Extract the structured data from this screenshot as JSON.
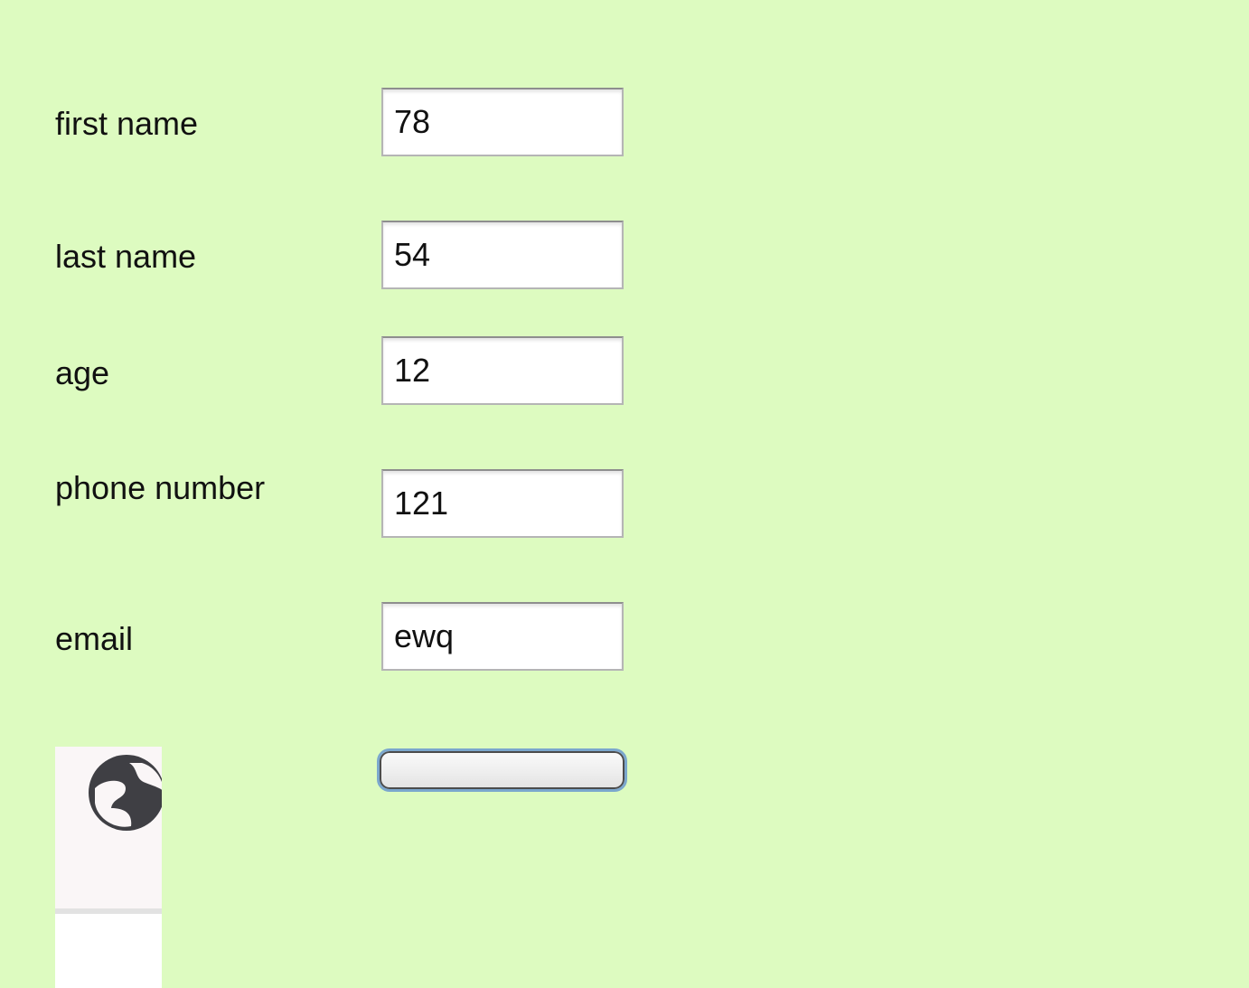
{
  "form": {
    "fields": [
      {
        "label": "first name",
        "value": "78"
      },
      {
        "label": "last name",
        "value": "54"
      },
      {
        "label": "age",
        "value": "12"
      },
      {
        "label": "phone number",
        "value": "121"
      },
      {
        "label": "email",
        "value": "ewq"
      }
    ],
    "submit_label": ""
  },
  "image": {
    "icon": "globe-icon",
    "bg_color": "#faf6f7"
  },
  "colors": {
    "background": "#ddfbc0",
    "button_border": "#7ba7cd"
  }
}
